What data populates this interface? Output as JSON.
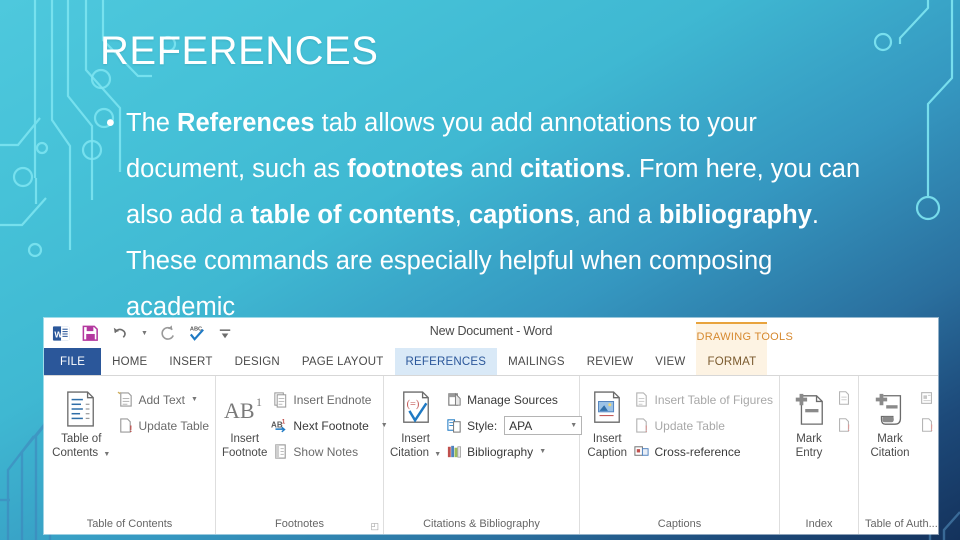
{
  "slide": {
    "title": "REFERENCES",
    "bullet_marker": "•",
    "body_runs": [
      {
        "text": "The ",
        "bold": false
      },
      {
        "text": "References",
        "bold": true
      },
      {
        "text": " tab allows you add annotations to your document, such as ",
        "bold": false
      },
      {
        "text": "footnotes",
        "bold": true
      },
      {
        "text": " and ",
        "bold": false
      },
      {
        "text": "citations",
        "bold": true
      },
      {
        "text": ". From here, you can also add a ",
        "bold": false
      },
      {
        "text": "table of contents",
        "bold": true
      },
      {
        "text": ", ",
        "bold": false
      },
      {
        "text": "captions",
        "bold": true
      },
      {
        "text": ", and a ",
        "bold": false
      },
      {
        "text": "bibliography",
        "bold": true
      },
      {
        "text": ". These commands are especially helpful when composing academic",
        "bold": false
      }
    ],
    "colors": {
      "bg_top": "#4ec8dd",
      "bg_bottom": "#14325c",
      "circuit_light": "#7fe6f2",
      "circuit_dark": "#2f6ea8",
      "text": "#ffffff"
    }
  },
  "ribbon": {
    "doc_title": "New Document - Word",
    "quick_access": [
      {
        "name": "word-app-icon",
        "label": "W"
      },
      {
        "name": "save-icon",
        "label": "Save"
      },
      {
        "name": "undo-icon",
        "label": "Undo"
      },
      {
        "name": "redo-icon",
        "label": "Redo"
      },
      {
        "name": "spelling-icon",
        "label": "ABC"
      },
      {
        "name": "customize-qat-icon",
        "label": "Customize"
      }
    ],
    "tabs": [
      {
        "label": "FILE",
        "state": "file"
      },
      {
        "label": "HOME",
        "state": "normal"
      },
      {
        "label": "INSERT",
        "state": "normal"
      },
      {
        "label": "DESIGN",
        "state": "normal"
      },
      {
        "label": "PAGE LAYOUT",
        "state": "normal"
      },
      {
        "label": "REFERENCES",
        "state": "active"
      },
      {
        "label": "MAILINGS",
        "state": "normal"
      },
      {
        "label": "REVIEW",
        "state": "normal"
      },
      {
        "label": "VIEW",
        "state": "normal"
      },
      {
        "label": "FORMAT",
        "state": "contextual"
      }
    ],
    "contextual_tab_label": "DRAWING TOOLS",
    "groups": [
      {
        "name": "table-of-contents",
        "label": "Table of Contents",
        "big_button": {
          "label_line1": "Table of",
          "label_line2": "Contents",
          "has_caret": true
        },
        "small_buttons": [
          {
            "label": "Add Text",
            "has_caret": true
          },
          {
            "label": "Update Table",
            "has_caret": false
          }
        ]
      },
      {
        "name": "footnotes",
        "label": "Footnotes",
        "has_dialog_launcher": true,
        "big_button": {
          "label_line1": "Insert",
          "label_line2": "Footnote",
          "has_caret": false
        },
        "small_buttons": [
          {
            "label": "Insert Endnote",
            "has_caret": false
          },
          {
            "label": "Next Footnote",
            "has_caret": true
          },
          {
            "label": "Show Notes",
            "has_caret": false
          }
        ]
      },
      {
        "name": "citations-bibliography",
        "label": "Citations & Bibliography",
        "big_button": {
          "label_line1": "Insert",
          "label_line2": "Citation",
          "has_caret": true
        },
        "small_buttons": [
          {
            "label": "Manage Sources",
            "has_caret": false
          },
          {
            "label": "Style:",
            "has_caret": false,
            "select_value": "APA"
          },
          {
            "label": "Bibliography",
            "has_caret": true
          }
        ]
      },
      {
        "name": "captions",
        "label": "Captions",
        "big_button": {
          "label_line1": "Insert",
          "label_line2": "Caption",
          "has_caret": false
        },
        "small_buttons": [
          {
            "label": "Insert Table of Figures",
            "has_caret": false
          },
          {
            "label": "Update Table",
            "has_caret": false
          },
          {
            "label": "Cross-reference",
            "has_caret": false
          }
        ]
      },
      {
        "name": "index",
        "label": "Index",
        "big_button": {
          "label_line1": "Mark",
          "label_line2": "Entry",
          "has_caret": false
        },
        "small_buttons": []
      },
      {
        "name": "table-of-authorities",
        "label": "Table of Auth...",
        "big_button": {
          "label_line1": "Mark",
          "label_line2": "Citation",
          "has_caret": false
        },
        "small_buttons": []
      }
    ]
  }
}
